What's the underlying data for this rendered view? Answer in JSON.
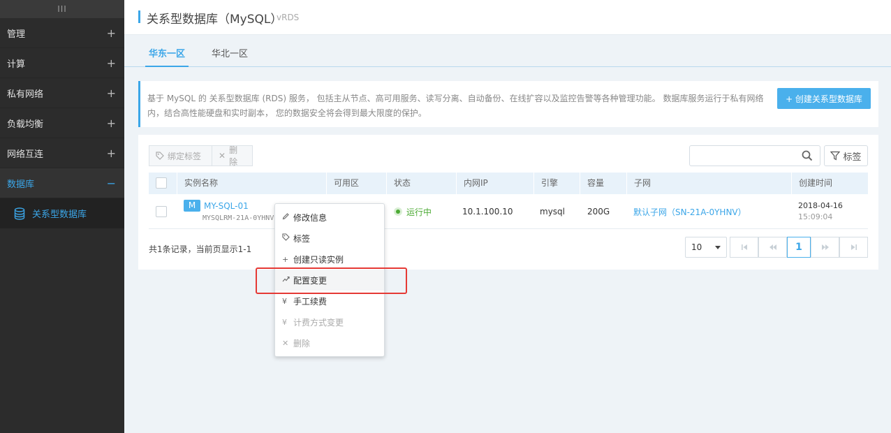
{
  "sidebar": {
    "top_icon": "III",
    "items": [
      {
        "label": "管理",
        "toggle": "+"
      },
      {
        "label": "计算",
        "toggle": "+"
      },
      {
        "label": "私有网络",
        "toggle": "+"
      },
      {
        "label": "负载均衡",
        "toggle": "+"
      },
      {
        "label": "网络互连",
        "toggle": "+"
      },
      {
        "label": "数据库",
        "toggle": "−"
      }
    ],
    "sub_item": {
      "label": "关系型数据库",
      "icon": "database-icon"
    }
  },
  "header": {
    "title": "关系型数据库（MySQL）",
    "subtitle": "vRDS"
  },
  "tabs": [
    {
      "label": "华东一区"
    },
    {
      "label": "华北一区"
    }
  ],
  "info": {
    "text": "基于 MySQL 的 关系型数据库 (RDS) 服务， 包括主从节点、高可用服务、读写分离、自动备份、在线扩容以及监控告警等各种管理功能。 数据库服务运行于私有网络内，结合高性能硬盘和实时副本， 您的数据安全将会得到最大限度的保护。",
    "create_button": "+ 创建关系型数据库"
  },
  "toolbar": {
    "bind_tag": "绑定标签",
    "delete": "删除",
    "search_placeholder": "",
    "tag_filter": "标签"
  },
  "table": {
    "headers": [
      "实例名称",
      "可用区",
      "状态",
      "内网IP",
      "引擎",
      "容量",
      "子网",
      "创建时间"
    ],
    "row": {
      "badge": "M",
      "name": "MY-SQL-01",
      "id": "MYSQLRM-21A-0YHNV",
      "status": "运行中",
      "ip": "10.1.100.10",
      "engine": "mysql",
      "capacity": "200G",
      "subnet": "默认子网（SN-21A-0YHNV）",
      "created_date": "2018-04-16",
      "created_time": "15:09:04"
    }
  },
  "footer": {
    "summary": "共1条记录，当前页显示1-1",
    "page_size": "10",
    "current_page": "1"
  },
  "context_menu": {
    "items": [
      {
        "label": "修改信息",
        "icon": "pencil-icon"
      },
      {
        "label": "标签",
        "icon": "tag-icon"
      },
      {
        "label": "创建只读实例",
        "icon": "plus-icon"
      },
      {
        "label": "配置变更",
        "icon": "trend-icon"
      },
      {
        "label": "手工续费",
        "icon": "yen-icon"
      },
      {
        "label": "计费方式变更",
        "icon": "yen-icon"
      },
      {
        "label": "删除",
        "icon": "close-icon"
      }
    ]
  },
  "colors": {
    "accent": "#3ba6e8",
    "status_ok": "#4caa34",
    "highlight": "#e53935",
    "sidebar_bg": "#2c2c2c"
  }
}
